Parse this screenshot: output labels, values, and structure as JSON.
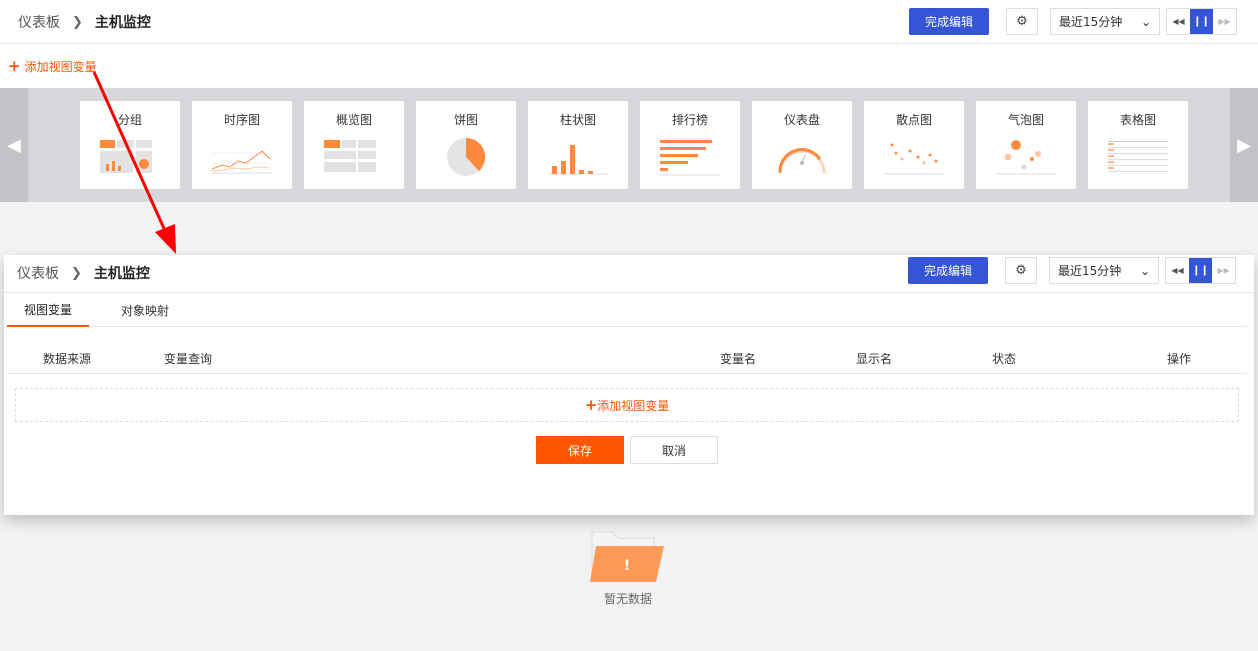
{
  "top": {
    "breadcrumb": {
      "root": "仪表板",
      "current": "主机监控"
    },
    "done_button": "完成编辑",
    "time_range": "最近15分钟",
    "add_var": "添加视图变量"
  },
  "palette": {
    "cards": [
      {
        "label": "分组",
        "icon": "group-chart-icon"
      },
      {
        "label": "时序图",
        "icon": "timeseries-chart-icon"
      },
      {
        "label": "概览图",
        "icon": "overview-chart-icon"
      },
      {
        "label": "饼图",
        "icon": "pie-chart-icon"
      },
      {
        "label": "柱状图",
        "icon": "bar-chart-icon"
      },
      {
        "label": "排行榜",
        "icon": "ranking-chart-icon"
      },
      {
        "label": "仪表盘",
        "icon": "gauge-chart-icon"
      },
      {
        "label": "散点图",
        "icon": "scatter-chart-icon"
      },
      {
        "label": "气泡图",
        "icon": "bubble-chart-icon"
      },
      {
        "label": "表格图",
        "icon": "table-chart-icon"
      }
    ]
  },
  "overlay": {
    "breadcrumb": {
      "root": "仪表板",
      "current": "主机监控"
    },
    "done_button": "完成编辑",
    "time_range": "最近15分钟",
    "tabs": [
      {
        "label": "视图变量"
      },
      {
        "label": "对象映射"
      }
    ],
    "columns": [
      "数据来源",
      "变量查询",
      "变量名",
      "显示名",
      "状态",
      "操作"
    ],
    "add_var": "添加视图变量",
    "save": "保存",
    "cancel": "取消"
  },
  "empty": {
    "text": "暂无数据"
  },
  "colors": {
    "accent": "#ff5500",
    "primary": "#3355d6",
    "arrow": "#ff0000"
  }
}
